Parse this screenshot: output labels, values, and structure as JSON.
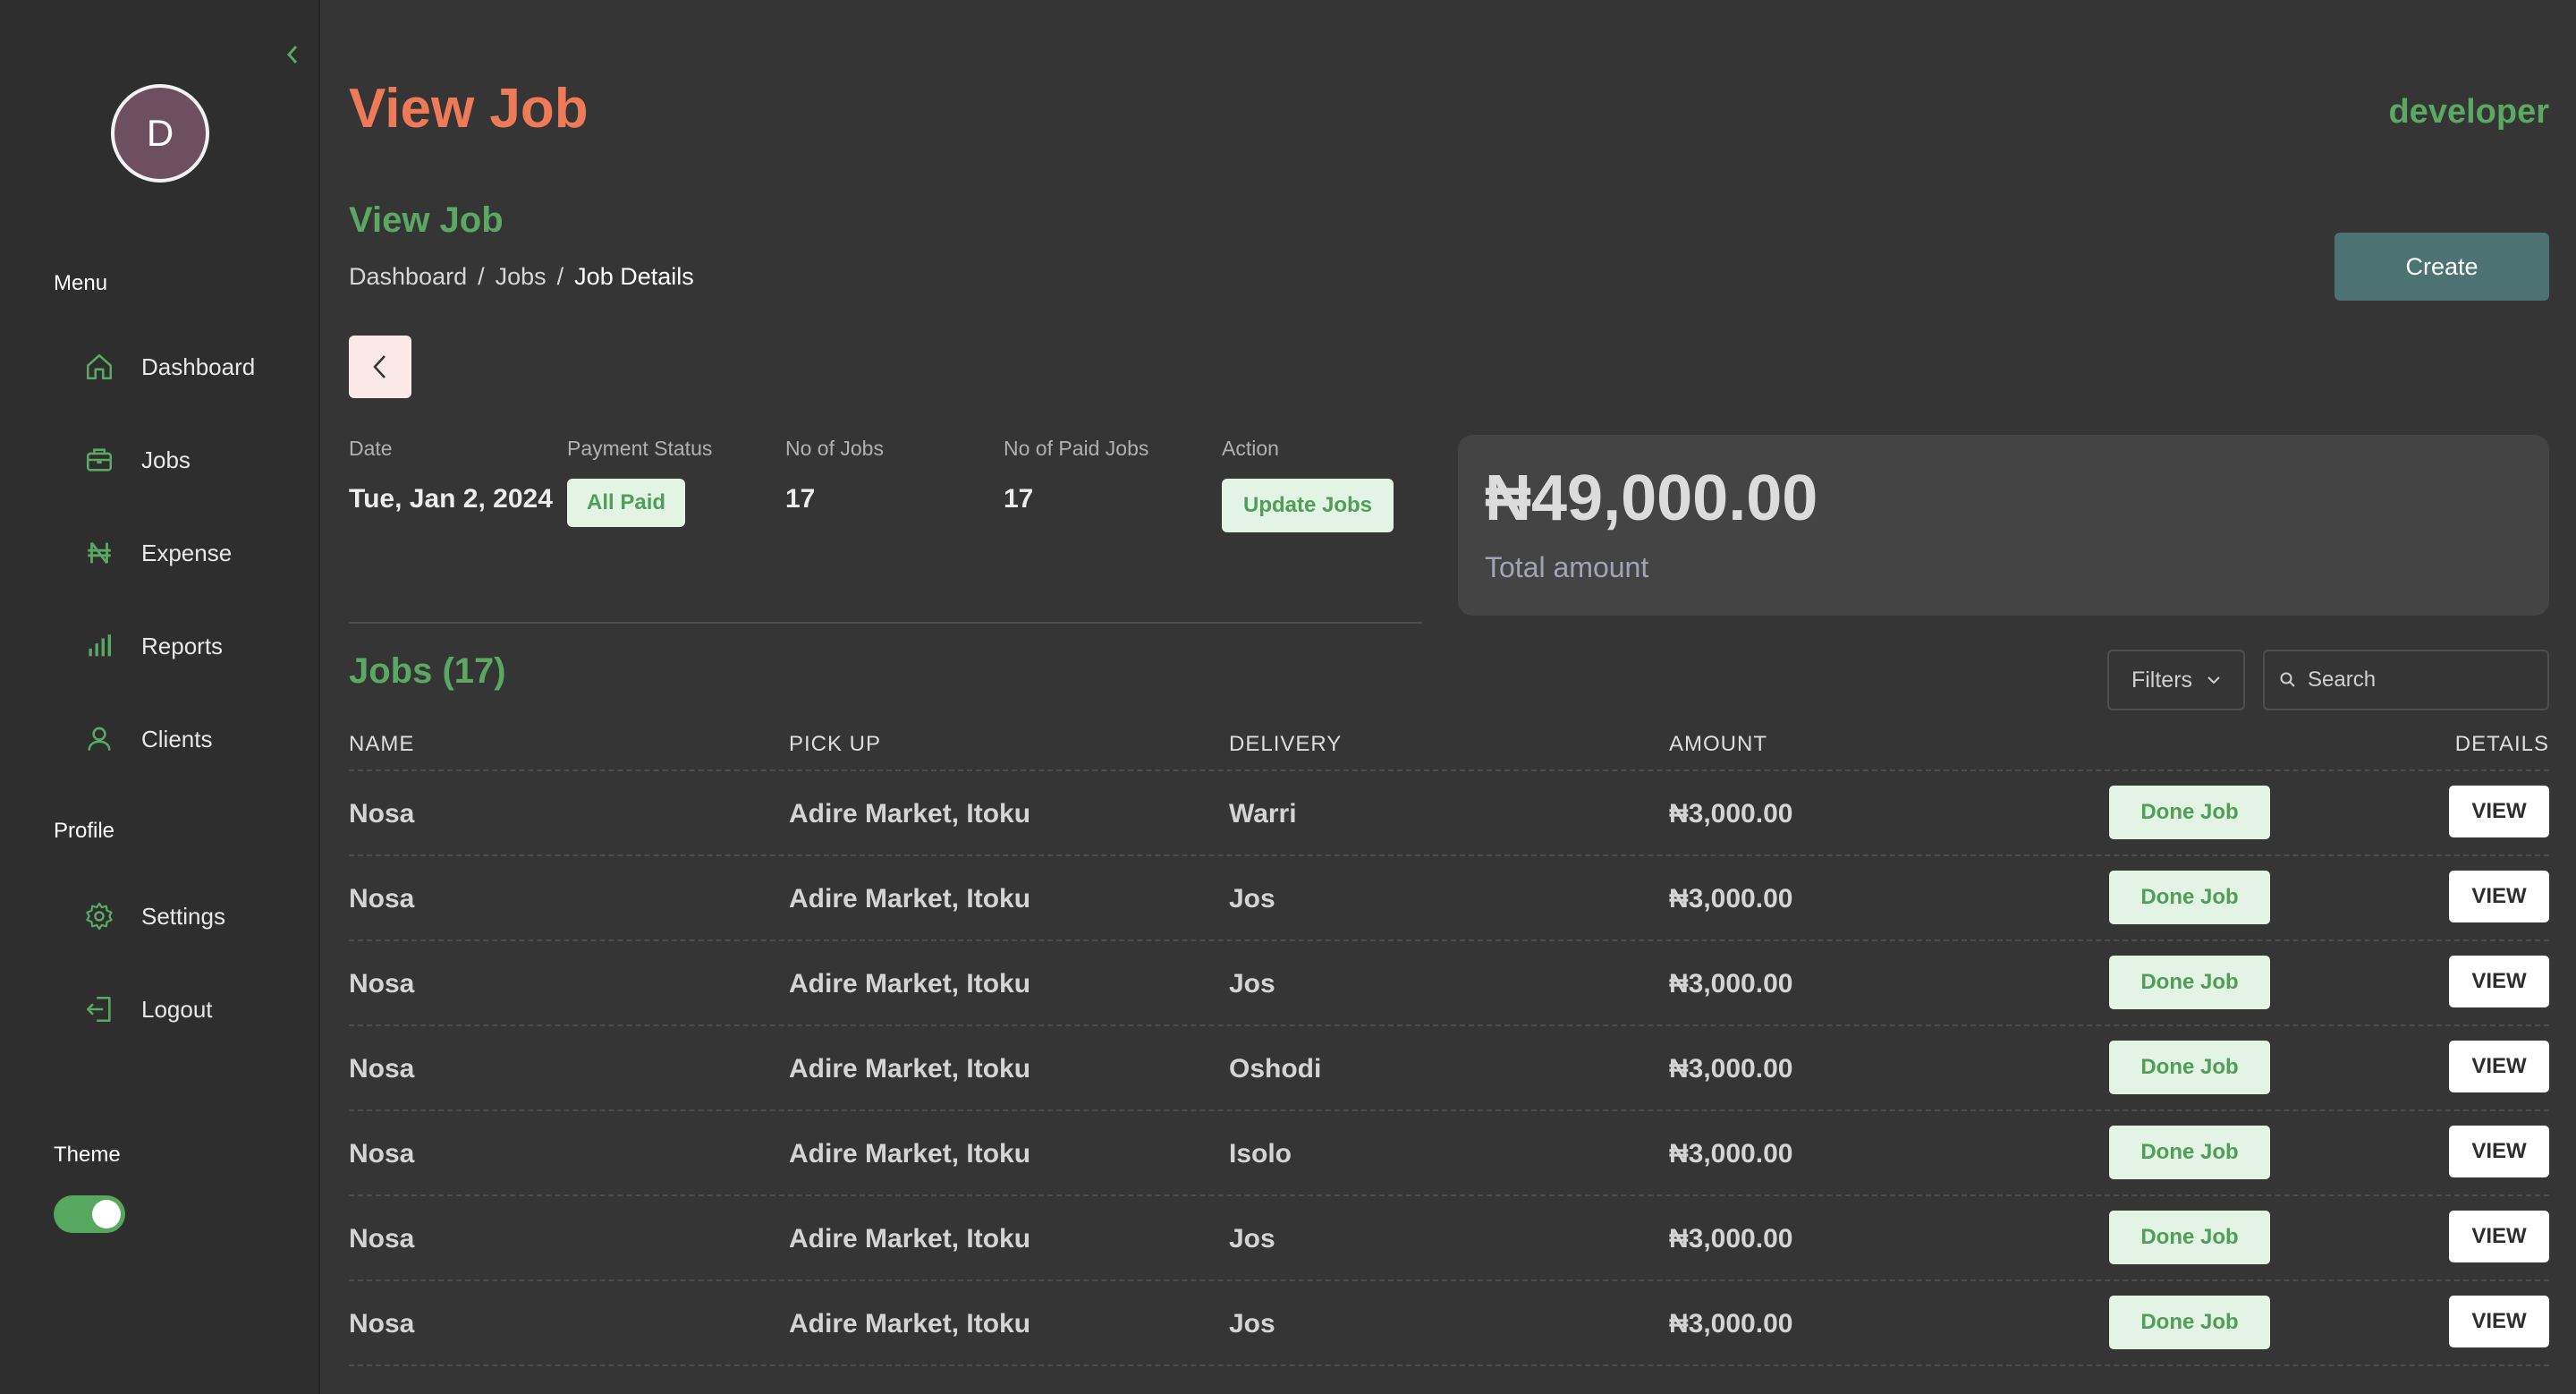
{
  "sidebar": {
    "avatar_initial": "D",
    "menu_label": "Menu",
    "items": [
      {
        "label": "Dashboard",
        "icon": "home-icon"
      },
      {
        "label": "Jobs",
        "icon": "briefcase-icon"
      },
      {
        "label": "Expense",
        "icon": "naira-icon"
      },
      {
        "label": "Reports",
        "icon": "bar-chart-icon"
      },
      {
        "label": "Clients",
        "icon": "user-icon"
      }
    ],
    "profile_label": "Profile",
    "profile_items": [
      {
        "label": "Settings",
        "icon": "gear-icon"
      },
      {
        "label": "Logout",
        "icon": "logout-icon"
      }
    ],
    "theme_label": "Theme",
    "theme_on": true
  },
  "header": {
    "title": "View Job",
    "user": "developer",
    "subtitle": "View Job",
    "breadcrumb": [
      "Dashboard",
      "Jobs",
      "Job Details"
    ],
    "create_label": "Create"
  },
  "summary": {
    "date_label": "Date",
    "date_value": "Tue, Jan 2, 2024",
    "payment_label": "Payment Status",
    "payment_value": "All Paid",
    "jobs_label": "No of Jobs",
    "jobs_value": "17",
    "paid_label": "No of Paid Jobs",
    "paid_value": "17",
    "action_label": "Action",
    "action_button": "Update Jobs",
    "total_amount": "₦49,000.00",
    "total_label": "Total amount"
  },
  "jobs": {
    "title": "Jobs (17)",
    "filters_label": "Filters",
    "search_placeholder": "Search",
    "columns": [
      "NAME",
      "PICK UP",
      "DELIVERY",
      "AMOUNT",
      "DETAILS"
    ],
    "rows": [
      {
        "name": "Nosa",
        "pickup": "Adire Market, Itoku",
        "delivery": "Warri",
        "amount": "₦3,000.00",
        "status": "Done Job",
        "view": "VIEW"
      },
      {
        "name": "Nosa",
        "pickup": "Adire Market, Itoku",
        "delivery": "Jos",
        "amount": "₦3,000.00",
        "status": "Done Job",
        "view": "VIEW"
      },
      {
        "name": "Nosa",
        "pickup": "Adire Market, Itoku",
        "delivery": "Jos",
        "amount": "₦3,000.00",
        "status": "Done Job",
        "view": "VIEW"
      },
      {
        "name": "Nosa",
        "pickup": "Adire Market, Itoku",
        "delivery": "Oshodi",
        "amount": "₦3,000.00",
        "status": "Done Job",
        "view": "VIEW"
      },
      {
        "name": "Nosa",
        "pickup": "Adire Market, Itoku",
        "delivery": "Isolo",
        "amount": "₦3,000.00",
        "status": "Done Job",
        "view": "VIEW"
      },
      {
        "name": "Nosa",
        "pickup": "Adire Market, Itoku",
        "delivery": "Jos",
        "amount": "₦3,000.00",
        "status": "Done Job",
        "view": "VIEW"
      },
      {
        "name": "Nosa",
        "pickup": "Adire Market, Itoku",
        "delivery": "Jos",
        "amount": "₦3,000.00",
        "status": "Done Job",
        "view": "VIEW"
      }
    ]
  },
  "colors": {
    "accent_green": "#5aa862",
    "title_orange": "#ef7a57",
    "create_teal": "#4c7372"
  }
}
